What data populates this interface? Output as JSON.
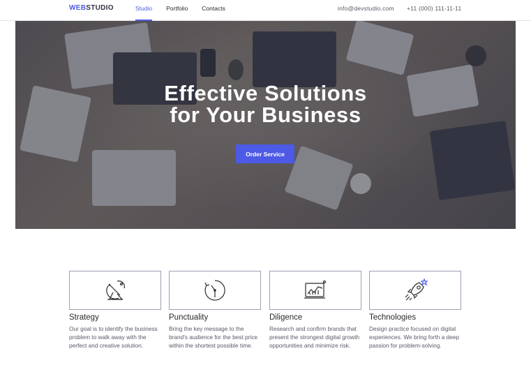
{
  "header": {
    "logo": {
      "part1": "WEB",
      "part2": "STUDIO"
    },
    "nav": [
      {
        "label": "Studio"
      },
      {
        "label": "Portfolio"
      },
      {
        "label": "Contacts"
      }
    ],
    "email": "info@devstudio.com",
    "phone": "+11 (000) 111-11-11"
  },
  "hero": {
    "title_line1": "Effective Solutions",
    "title_line2": "for Your Business",
    "button_label": "Order Service"
  },
  "features": [
    {
      "icon": "satellite-dish-icon",
      "title": "Strategy",
      "description": "Our goal is to identify the business problem to walk away with the perfect and creative solution."
    },
    {
      "icon": "clock-icon",
      "title": "Punctuality",
      "description": "Bring the key message to the brand's audience for the best price within the shortest possible time."
    },
    {
      "icon": "chart-monitor-icon",
      "title": "Diligence",
      "description": "Research and confirm brands that present the strongest digital growth opportunities and minimize risk."
    },
    {
      "icon": "rocket-icon",
      "title": "Technologies",
      "description": "Design practice focused on digital experiences. We bring forth a deep passion for problem-solving."
    }
  ],
  "colors": {
    "accent": "#4d5ae5",
    "text": "#2a2a2a",
    "muted_text": "#555a66",
    "border": "#9aa0b3"
  }
}
